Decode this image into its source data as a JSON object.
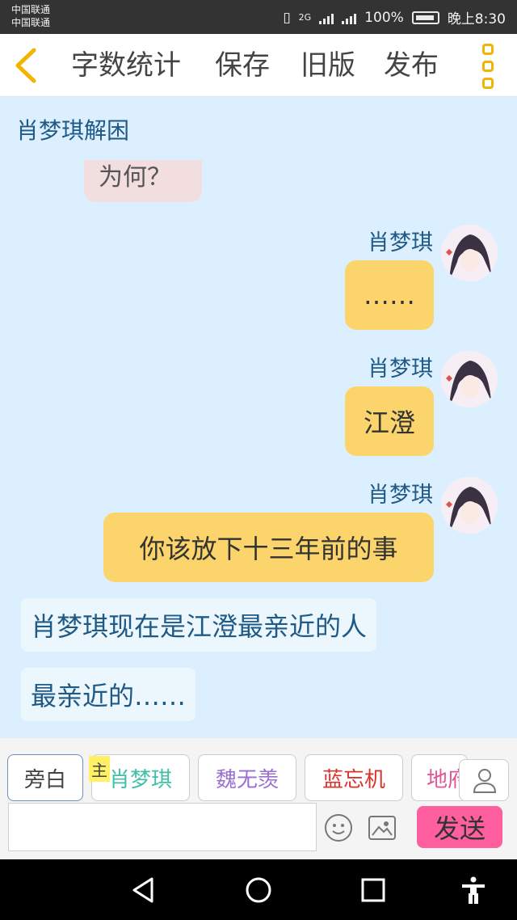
{
  "status": {
    "carrier1": "中国联通",
    "carrier2": "中国联通",
    "network": "2G",
    "battery": "100%",
    "time": "晚上8:30"
  },
  "toolbar": {
    "word_count": "字数统计",
    "save": "保存",
    "old_version": "旧版",
    "publish": "发布"
  },
  "chat": {
    "title": "肖梦琪解困",
    "messages": [
      {
        "text": "为何？"
      },
      {
        "sender": "肖梦琪",
        "text": "……"
      },
      {
        "sender": "肖梦琪",
        "text": "江澄"
      },
      {
        "sender": "肖梦琪",
        "text": "你该放下十三年前的事"
      },
      {
        "text": "肖梦琪现在是江澄最亲近的人"
      },
      {
        "text": "最亲近的……"
      }
    ]
  },
  "roles": {
    "narration": "旁白",
    "host_tag": "主",
    "items": [
      {
        "label": "肖梦琪",
        "color": "#3fbfa8"
      },
      {
        "label": "魏无羡",
        "color": "#9b6fd0"
      },
      {
        "label": "蓝忘机",
        "color": "#d9342b"
      },
      {
        "label": "地府",
        "color": "#e0559a"
      }
    ]
  },
  "input": {
    "placeholder": "",
    "send": "发送"
  },
  "colors": {
    "accent": "#f2b400",
    "my_bubble": "#fbd56b",
    "chat_bg": "#dcefff",
    "send_button": "#ff5f9e"
  }
}
